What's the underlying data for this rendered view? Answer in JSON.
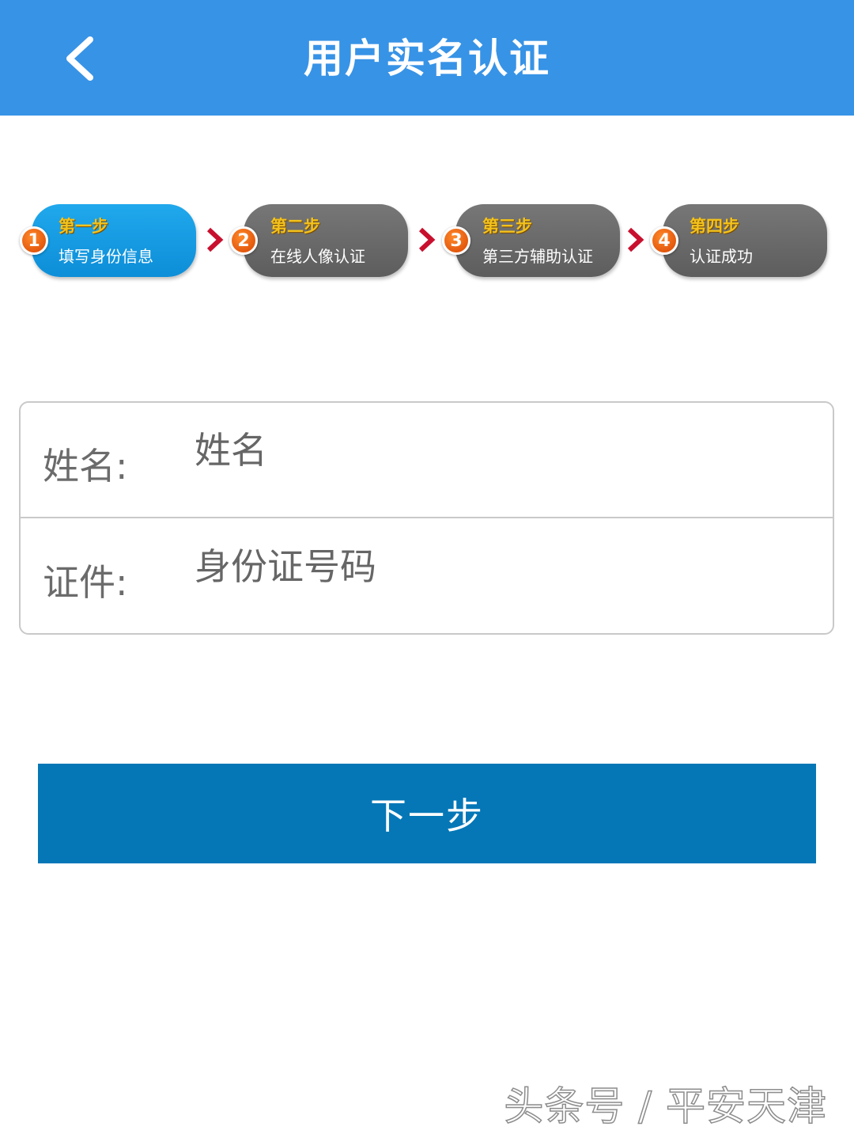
{
  "header": {
    "title": "用户实名认证",
    "back_icon": "chevron-left-icon"
  },
  "steps": [
    {
      "number": "1",
      "title": "第一步",
      "label": "填写身份信息",
      "state": "active"
    },
    {
      "number": "2",
      "title": "第二步",
      "label": "在线人像认证",
      "state": "pending"
    },
    {
      "number": "3",
      "title": "第三步",
      "label": "第三方辅助认证",
      "state": "pending"
    },
    {
      "number": "4",
      "title": "第四步",
      "label": "认证成功",
      "state": "pending"
    }
  ],
  "form": {
    "name_label": "姓名:",
    "name_placeholder": "姓名",
    "id_label": "证件:",
    "id_placeholder": "身份证号码"
  },
  "next_button": "下一步",
  "watermark": "头条号 / 平安天津",
  "colors": {
    "header": "#3793e6",
    "active_step": "#0d8ed8",
    "pending_step": "#666666",
    "step_number": "#e0520a",
    "step_arrow": "#c8102e",
    "button": "#0577b7"
  }
}
